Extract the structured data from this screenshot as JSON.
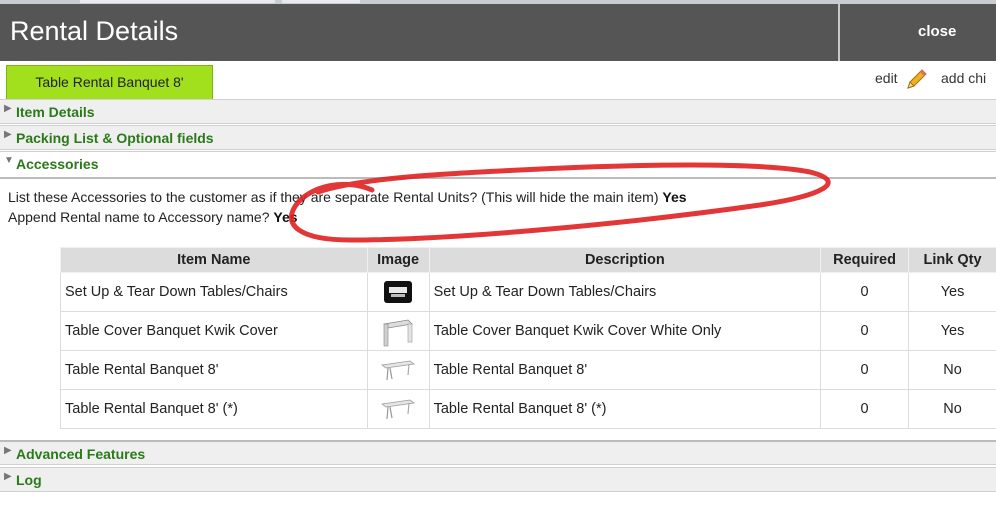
{
  "header": {
    "title": "Rental Details",
    "close_label": "close"
  },
  "tabs": {
    "active_label": "Table Rental Banquet 8'",
    "edit_label": "edit",
    "add_child_label": "add chi"
  },
  "sections": {
    "item_details": "Item Details",
    "packing_list": "Packing List & Optional fields",
    "accessories": "Accessories",
    "advanced": "Advanced Features",
    "log": "Log"
  },
  "accessories": {
    "list_question": "List these Accessories to the customer as if they are separate Rental Units? (This will hide the main item)",
    "list_answer": "Yes",
    "append_question": "Append Rental name to Accessory name?",
    "append_answer": "Yes"
  },
  "table": {
    "headers": [
      "Item Name",
      "Image",
      "Description",
      "Required",
      "Link Qty"
    ],
    "rows": [
      {
        "name": "Set Up & Tear Down Tables/Chairs",
        "image": "setup-thumbnail",
        "description": "Set Up & Tear Down Tables/Chairs",
        "required": "0",
        "link_qty": "Yes"
      },
      {
        "name": "Table Cover Banquet Kwik Cover",
        "image": "table-cover-thumbnail",
        "description": "Table Cover Banquet Kwik Cover White Only",
        "required": "0",
        "link_qty": "Yes"
      },
      {
        "name": "Table Rental Banquet 8'",
        "image": "banquet-table-thumbnail",
        "description": "Table Rental Banquet 8'",
        "required": "0",
        "link_qty": "No"
      },
      {
        "name": "Table Rental Banquet 8' (*)",
        "image": "banquet-table-thumbnail",
        "description": "Table Rental Banquet 8' (*)",
        "required": "0",
        "link_qty": "No"
      }
    ]
  },
  "colors": {
    "header_bg": "#555555",
    "active_tab": "#a2e01d",
    "section_label": "#2a7a19",
    "annotation": "#e02020"
  },
  "icons": {
    "edit": "pencil-icon",
    "collapsed": "triangle-right-icon",
    "expanded": "triangle-down-icon"
  }
}
